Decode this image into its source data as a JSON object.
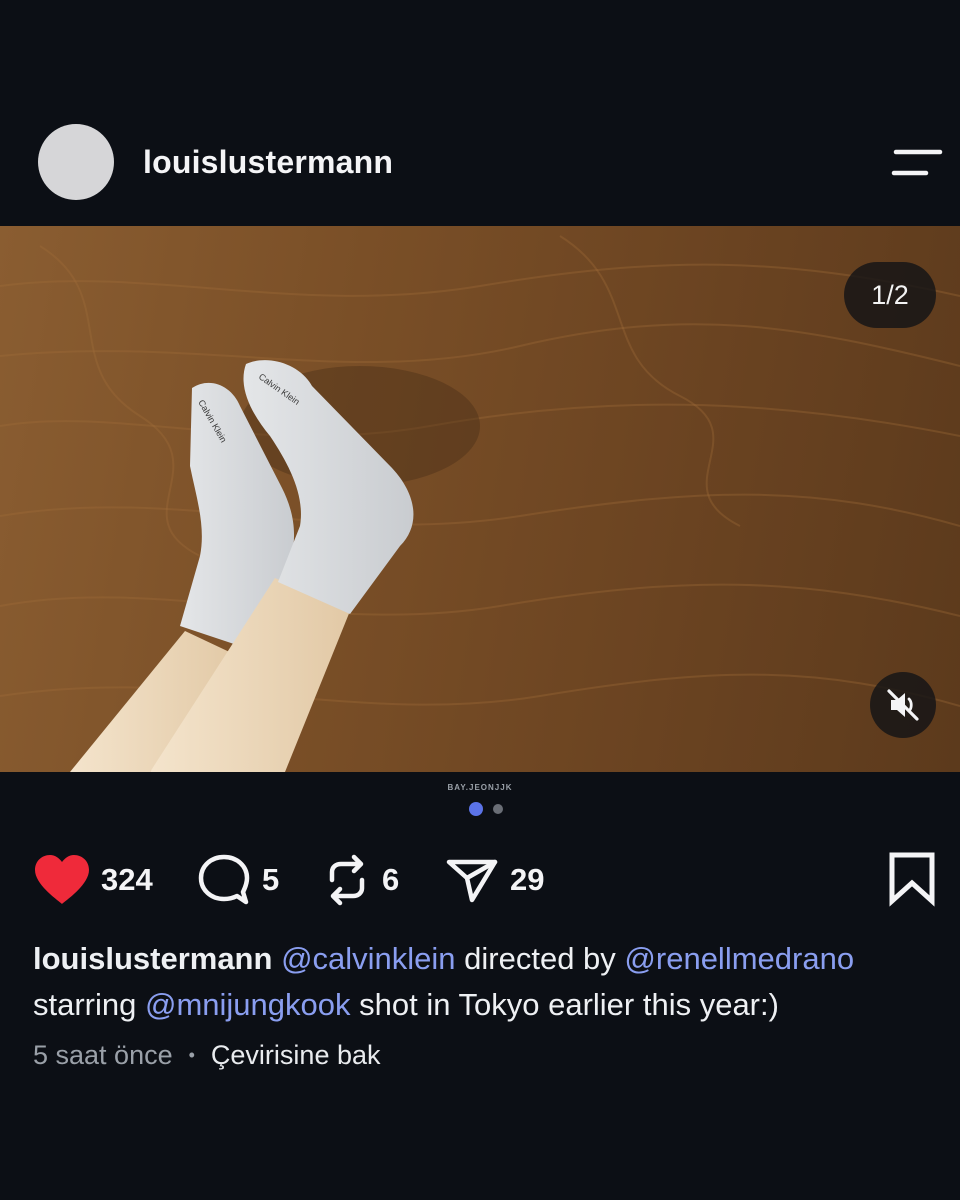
{
  "post": {
    "username": "louislustermann",
    "media_counter": "1/2",
    "watermark": "BAY.JEONJJK",
    "carousel": {
      "current": 1,
      "total": 2
    }
  },
  "actions": {
    "likes": "324",
    "comments": "5",
    "reposts": "6",
    "shares": "29"
  },
  "caption": {
    "author": "louislustermann",
    "mention_1": "@calvinklein",
    "text_1": " directed by ",
    "mention_2": "@renellmedrano",
    "text_2": "starring ",
    "mention_3": "@mnijungkook",
    "text_3": " shot in Tokyo earlier this year:)"
  },
  "meta": {
    "time": "5 saat önce",
    "separator": "•",
    "translate": "Çevirisine bak"
  },
  "icons": {
    "heart": "heart-icon",
    "comment": "comment-icon",
    "repost": "repost-icon",
    "share": "share-icon",
    "bookmark": "bookmark-icon",
    "menu": "menu-icon",
    "mute": "mute-icon"
  },
  "colors": {
    "background": "#0c0f15",
    "like": "#ef2a3a",
    "mention": "#8a9ef0",
    "active_dot": "#5b73e8"
  }
}
